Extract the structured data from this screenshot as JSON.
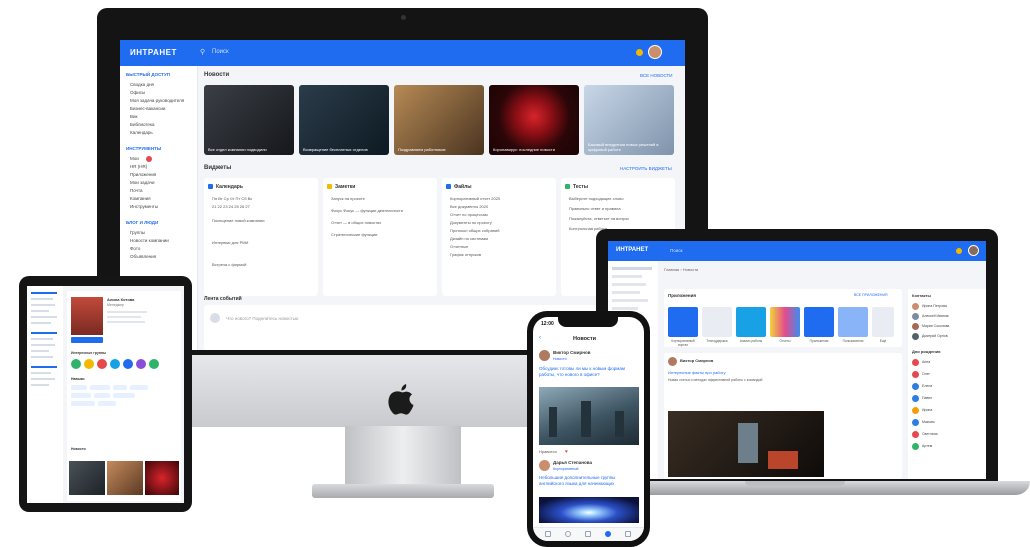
{
  "imac": {
    "brand": "ИНТРАНЕТ",
    "search_placeholder": "Поиск",
    "nav": {
      "section1": "БЫСТРЫЙ ДОСТУП",
      "items1": [
        "Сводка дня",
        "Офисы",
        "Моя задача руководителя",
        "Бизнес-вакансии",
        "Вик",
        "Библиотека",
        "Календарь"
      ],
      "section2": "ИНСТРУМЕНТЫ",
      "items2": [
        "Мои",
        "HR (HR)",
        "Приложения",
        "Мои задачи",
        "Почта",
        "Компания",
        "Инструменты"
      ],
      "section3": "БЛОГ И ЛЮДИ",
      "items3": [
        "Группы",
        "Новости компании",
        "Фото",
        "Объявления"
      ]
    },
    "news_title": "Новости",
    "news_all": "ВСЕ НОВОСТИ",
    "news_cards": [
      {
        "caption": "Все отдел компании подводили"
      },
      {
        "caption": "Возвращение бесплатных отделов"
      },
      {
        "caption": "Поздравляем работников"
      },
      {
        "caption": "Коронавирус: последние новости"
      },
      {
        "caption": "Базовый внедрения новых решений в цифровой работе"
      }
    ],
    "widgets_title": "Виджеты",
    "widgets_settings": "НАСТРОИТЬ ВИДЖЕТЫ",
    "widgets": [
      {
        "title": "Календарь",
        "color": "#1f6cf0",
        "lines": [
          "Пн  Вт  Ср  Чт  Пт  Сб  Вс",
          "21  22  23  24  25  26  27",
          "Посещение новой компании",
          "Интервью для РМИ",
          "Встреча с фирмой"
        ]
      },
      {
        "title": "Заметки",
        "color": "#f5b800",
        "lines": [
          "Запуск на проекте",
          "Фокус Фокус — функции деятельности",
          "Отчет — в общих новостях",
          "Стратегические функции"
        ]
      },
      {
        "title": "Файлы",
        "color": "#1f6cf0",
        "lines": [
          "Корпоративный отчет 2020",
          "Все документы 2020",
          "Отчет по процессам",
          "Документы по проекту",
          "Протокол общих собраний",
          "Дизайн по системам",
          "Отчетные",
          "График отпусков"
        ]
      },
      {
        "title": "Тесты",
        "color": "#2fb36a",
        "lines": [
          "Выберите подходящее слово",
          "Правильно ответ и правила",
          "Пожалуйста, ответьте на вопрос",
          "Контрольная работа"
        ]
      }
    ],
    "feed_title": "Лента событий",
    "feed_placeholder": "Что нового? Поделитесь новостью"
  },
  "laptop": {
    "brand": "ИНТРАНЕТ",
    "search_placeholder": "Поиск",
    "breadcrumb": "Главная › Новости",
    "tiles_title": "Приложения",
    "tiles_link": "ВСЕ ПРИЛОЖЕНИЯ",
    "tiles": [
      {
        "label": "Корпоративный портал",
        "color": "#1f6cf0"
      },
      {
        "label": "Техподдержка",
        "color": "#e9edf3"
      },
      {
        "label": "Анализ работы",
        "color": "#19a1e6"
      },
      {
        "label": "Отчеты",
        "color": "#f0f4fa"
      },
      {
        "label": "Приложения",
        "color": "#1f6cf0"
      },
      {
        "label": "Пользователи",
        "color": "#8ab4f8"
      },
      {
        "label": "Ещё",
        "color": "#e9edf3"
      }
    ],
    "post_author": "Виктор Смирнов",
    "post_title": "Интересные факты про работу",
    "post_text": "Новая статья о методах эффективной работы с командой",
    "right_section1": "Контакты",
    "right_users1": [
      "Ирина Петрова",
      "Алексей Иванов",
      "Мария Соколова",
      "Дмитрий Орлов"
    ],
    "right_section2": "Дни рождения",
    "right_users2": [
      "Анна",
      "Олег",
      "Елена",
      "Павел",
      "Ирина",
      "Максим",
      "Светлана",
      "Артем"
    ]
  },
  "tablet": {
    "profile_name": "Алина Котова",
    "profile_role": "Менеджер",
    "section_groups": "Интересные группы",
    "section_skills": "Навыки",
    "section_news": "Новости"
  },
  "phone": {
    "time": "12:00",
    "title": "Новости",
    "author1": "Виктор Смирнов",
    "meta1": "Новости",
    "headline1": "Обсудим: готовы ли мы к новым формам работы, что нового в офисе?",
    "likes": "Нравится",
    "author2": "Дарья Степанова",
    "meta2": "Корпоративный",
    "headline2": "Небольшие дополнительные группы английского языка для начинающих"
  }
}
